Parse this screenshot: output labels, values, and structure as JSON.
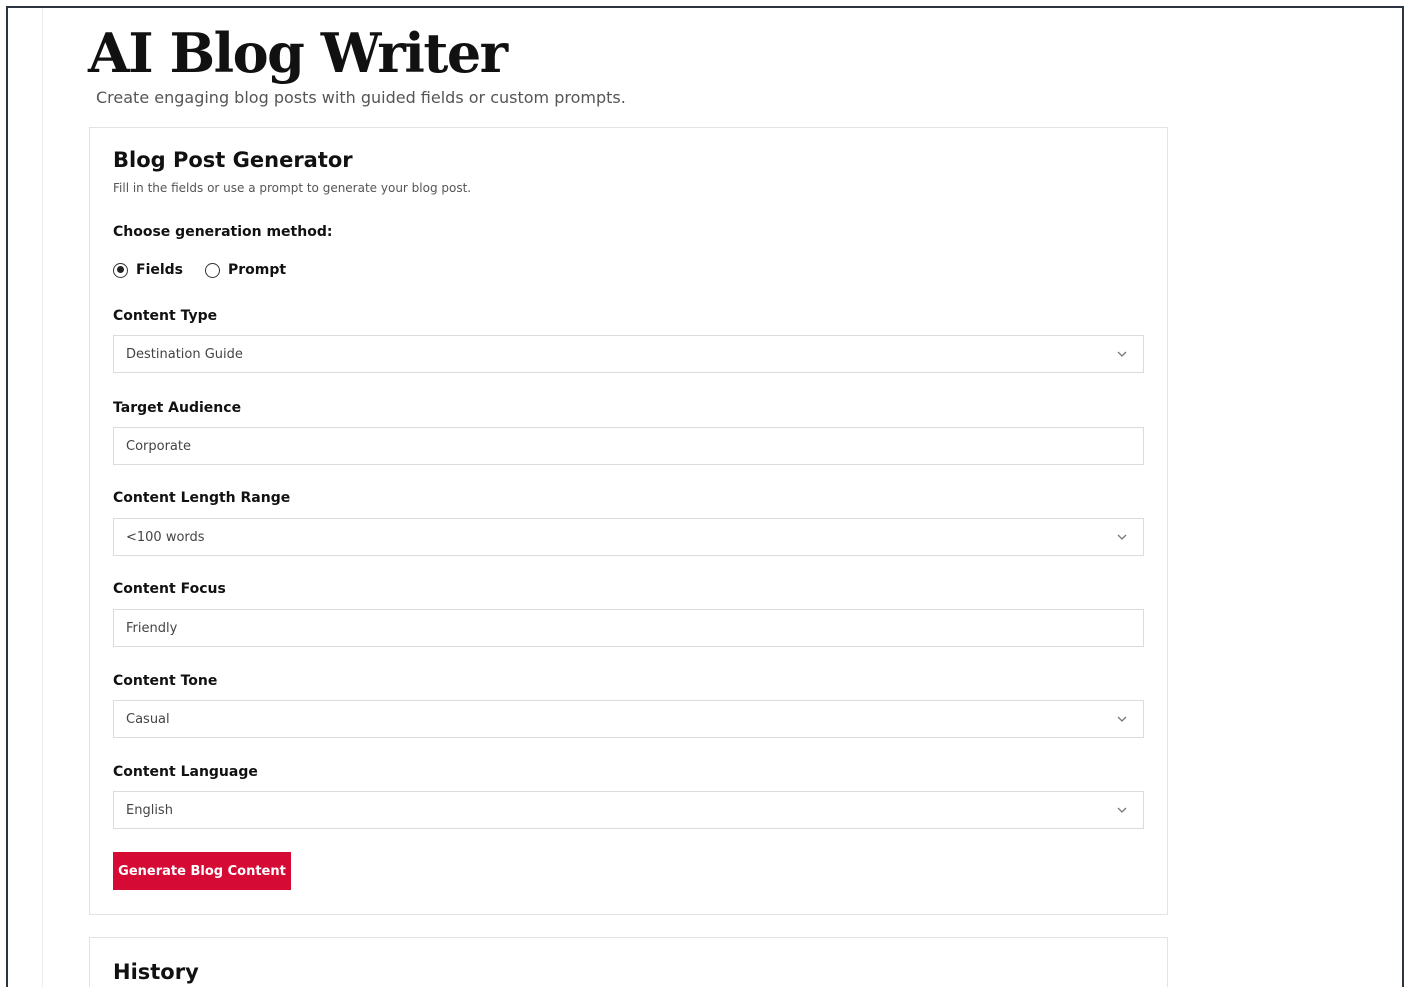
{
  "page": {
    "title": "AI Blog Writer",
    "subtitle": "Create engaging blog posts with guided fields or custom prompts."
  },
  "generator": {
    "title": "Blog Post Generator",
    "subtitle": "Fill in the fields or use a prompt to generate your blog post.",
    "method_label": "Choose generation method:",
    "methods": [
      {
        "label": "Fields",
        "checked": true
      },
      {
        "label": "Prompt",
        "checked": false
      }
    ],
    "fields": {
      "content_type": {
        "label": "Content Type",
        "value": "Destination Guide"
      },
      "target_audience": {
        "label": "Target Audience",
        "value": "Corporate"
      },
      "length_range": {
        "label": "Content Length Range",
        "value": "<100 words"
      },
      "content_focus": {
        "label": "Content Focus",
        "value": "Friendly"
      },
      "content_tone": {
        "label": "Content Tone",
        "value": "Casual"
      },
      "content_language": {
        "label": "Content Language",
        "value": "English"
      }
    },
    "generate_label": "Generate Blog Content",
    "accent_color": "#d50b36"
  },
  "history": {
    "title": "History"
  },
  "icons": {
    "select_arrow": "chevron-down-icon"
  }
}
